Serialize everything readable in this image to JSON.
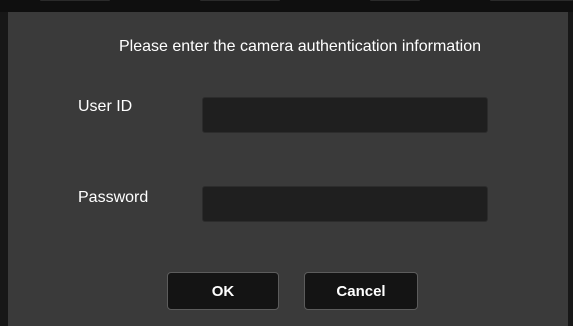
{
  "dialog": {
    "prompt": "Please enter the camera authentication information",
    "user_id": {
      "label": "User ID",
      "value": "",
      "placeholder": ""
    },
    "password": {
      "label": "Password",
      "value": "",
      "placeholder": ""
    },
    "buttons": {
      "ok_label": "OK",
      "cancel_label": "Cancel"
    }
  },
  "colors": {
    "dialog_background": "#3a3a3a",
    "input_background": "#1f1f1f",
    "button_background": "#141414",
    "button_border": "#5c5c5c",
    "text": "#ffffff"
  }
}
